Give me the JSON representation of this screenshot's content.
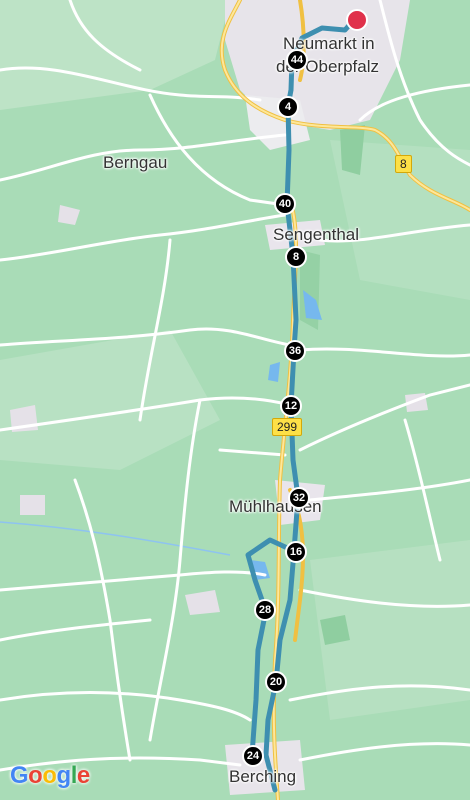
{
  "map": {
    "places": {
      "neumarkt_line1": "Neumarkt in",
      "neumarkt_line2": "der Oberpfalz",
      "berngau": "Berngau",
      "sengenthal": "Sengenthal",
      "muehlhausen": "Mühlhausen",
      "berching": "Berching"
    },
    "road_shields": {
      "r8": "8",
      "r299": "299"
    },
    "route_markers": [
      "44",
      "4",
      "40",
      "8",
      "36",
      "12",
      "32",
      "16",
      "28",
      "20",
      "24"
    ],
    "colors": {
      "land": "#a9dcb7",
      "route": "#3e8fb0",
      "major_road": "#fbd26a",
      "destination_pin": "#e0314b"
    },
    "logo": {
      "letters": [
        "G",
        "o",
        "o",
        "g",
        "l",
        "e"
      ],
      "colors": [
        "#4285f4",
        "#ea4335",
        "#fbbc05",
        "#4285f4",
        "#34a853",
        "#ea4335"
      ]
    }
  }
}
